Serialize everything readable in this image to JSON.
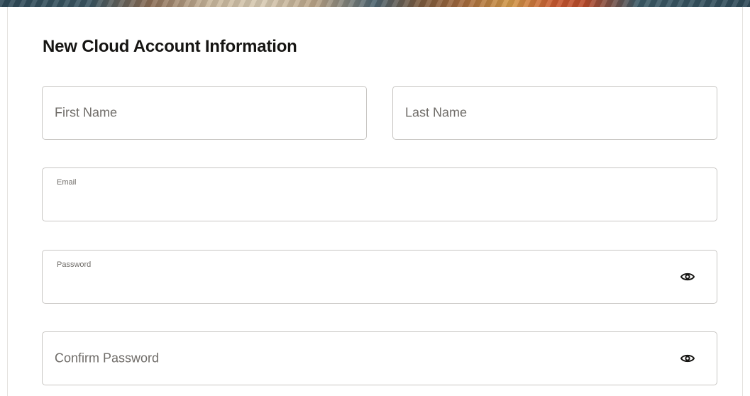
{
  "banner": {
    "colors": [
      "#2f4a58",
      "#c9b79c",
      "#a56a3c",
      "#d39a4a",
      "#b84a2a"
    ]
  },
  "form": {
    "title": "New Cloud Account Information",
    "first_name": {
      "placeholder": "First Name",
      "value": ""
    },
    "last_name": {
      "placeholder": "Last Name",
      "value": ""
    },
    "email": {
      "label": "Email",
      "value": ""
    },
    "password": {
      "label": "Password",
      "value": "",
      "toggle_icon": "eye-icon"
    },
    "confirm_password": {
      "placeholder": "Confirm Password",
      "value": "",
      "toggle_icon": "eye-icon"
    }
  }
}
